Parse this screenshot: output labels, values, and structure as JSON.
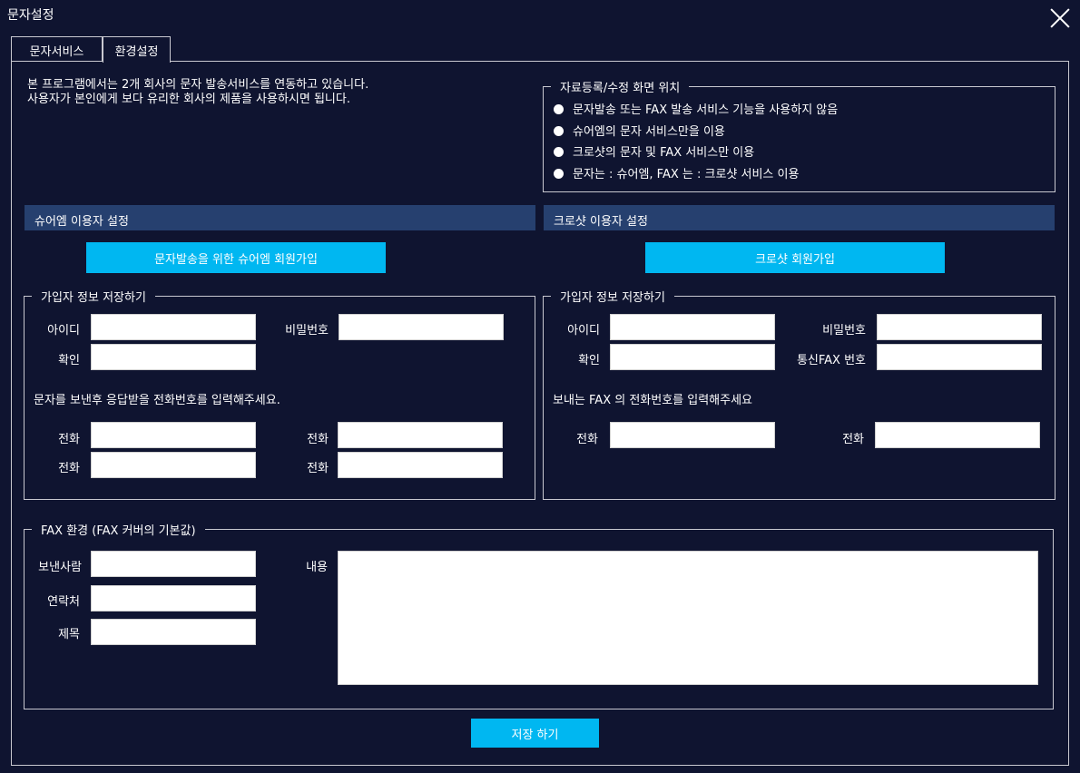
{
  "window": {
    "title": "문자설정"
  },
  "tabs": [
    {
      "label": "문자서비스"
    },
    {
      "label": "환경설정"
    }
  ],
  "intro": {
    "line1": "본 프로그램에서는 2개 회사의 문자 발송서비스를 연동하고 있습니다.",
    "line2": "사용자가 본인에게 보다 유리한 회사의 제품을 사용하시면 됩니다."
  },
  "position": {
    "legend": "자료등록/수정 화면 위치",
    "options": [
      "문자발송 또는 FAX 발송 서비스 기능을 사용하지 않음",
      "슈어엠의 문자 서비스만을 이용",
      "크로샷의 문자 및 FAX 서비스만 이용",
      "문자는 : 슈어엠, FAX 는 : 크로샷 서비스 이용"
    ]
  },
  "sureem": {
    "header": "슈어엠 이용자 설정",
    "signup_button": "문자발송을 위한 슈어엠 회원가입",
    "legend": "가입자 정보 저장하기",
    "id_label": "아이디",
    "pw_label": "비밀번호",
    "confirm_label": "확인",
    "phone_note": "문자를 보낸후 응답받을 전화번호를 입력해주세요.",
    "phone_label": "전화"
  },
  "crosshot": {
    "header": "크로샷 이용자 설정",
    "signup_button": "크로샷 회원가입",
    "legend": "가입자 정보 저장하기",
    "id_label": "아이디",
    "pw_label": "비밀번호",
    "confirm_label": "확인",
    "fax_label": "통신FAX 번호",
    "phone_note": "보내는 FAX 의 전화번호를 입력해주세요",
    "phone_label": "전화"
  },
  "fax": {
    "legend": "FAX 환경 (FAX 커버의 기본값)",
    "sender_label": "보낸사람",
    "contact_label": "연락처",
    "subject_label": "제목",
    "content_label": "내용"
  },
  "save_button": "저장 하기",
  "colors": {
    "background": "#0f1430",
    "section_header": "#26406f",
    "accent": "#00b7f1"
  }
}
